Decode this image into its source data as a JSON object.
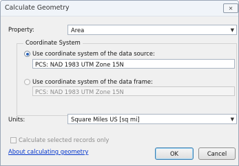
{
  "window": {
    "title": "Calculate Geometry",
    "close_icon": "close-icon"
  },
  "property": {
    "label": "Property:",
    "selected": "Area"
  },
  "coordinate_system": {
    "group_label": "Coordinate System",
    "option_source": {
      "label": "Use coordinate system of the data source:",
      "value": "PCS: NAD 1983 UTM Zone 15N",
      "selected": true
    },
    "option_frame": {
      "label": "Use coordinate system of the data frame:",
      "value": "PCS: NAD 1983 UTM Zone 15N",
      "selected": false
    }
  },
  "units": {
    "label": "Units:",
    "selected": "Square Miles US [sq mi]"
  },
  "selected_only": {
    "label": "Calculate selected records only",
    "checked": false,
    "enabled": false
  },
  "help_link": "About calculating geometry",
  "buttons": {
    "ok": "OK",
    "cancel": "Cancel"
  },
  "colors": {
    "link": "#0033cc",
    "radio_selected": "#2a62b8"
  }
}
